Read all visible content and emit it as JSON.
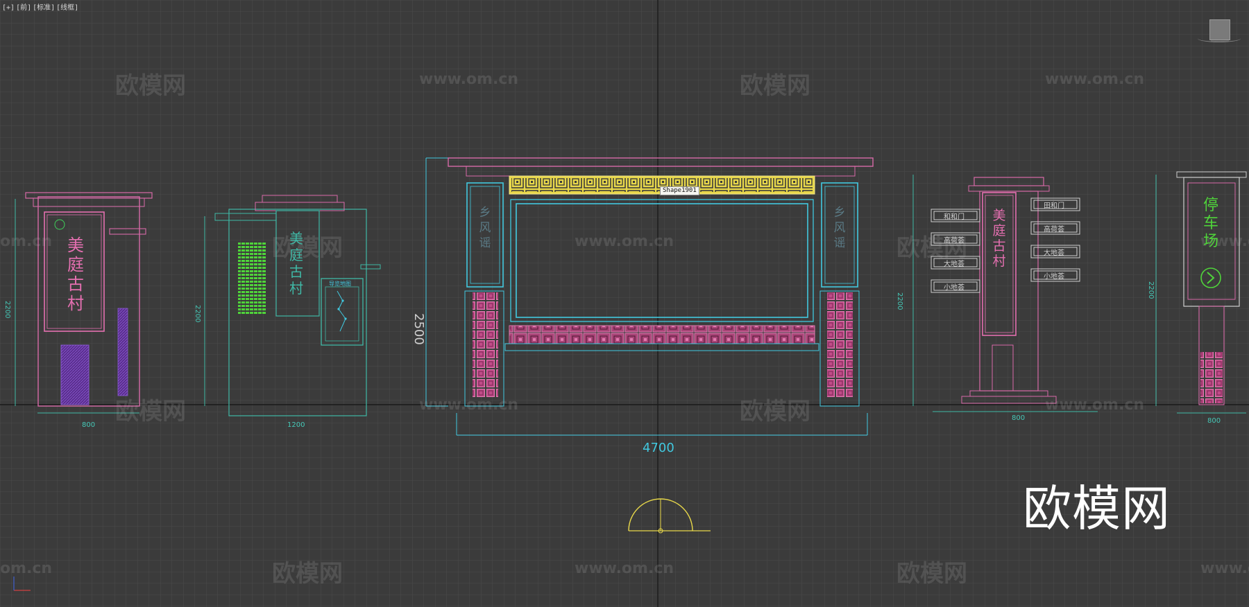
{
  "viewport": {
    "label_parts": [
      "[+]",
      "[前]",
      "[标准]",
      "[线框]"
    ],
    "tooltip": "Shape1901"
  },
  "watermarks": {
    "cn": "欧模网",
    "url": "www.om.cn",
    "partial_url": "om.cn",
    "partial_url2": "www.o"
  },
  "logo_text": "欧模网",
  "dimensions": {
    "sign1_width": "800",
    "sign1_height": "2200",
    "sign2_width": "1200",
    "sign2_height": "2200",
    "board_width": "4700",
    "board_height": "2500",
    "sign4_width": "800",
    "sign4_height": "2200",
    "sign5_width": "800",
    "sign5_height": "2200"
  },
  "signs": {
    "village_name": "美庭古村",
    "board_side_text": "乡风谣",
    "map_title": "导览地图",
    "directions": [
      "和和门",
      "高荷荟",
      "大地荟",
      "小地荟",
      "田和门",
      "高荷荟",
      "大地荟",
      "小地荟"
    ],
    "parking": "停车场"
  },
  "colors": {
    "background": "#3b3b3b",
    "grid": "#4a4a4a",
    "pink": "#d86aa8",
    "cyan": "#41c9e0",
    "teal": "#3fb8a6",
    "yellow": "#e8d84a",
    "purple": "#6d3aa8",
    "green": "#4fd43a"
  }
}
